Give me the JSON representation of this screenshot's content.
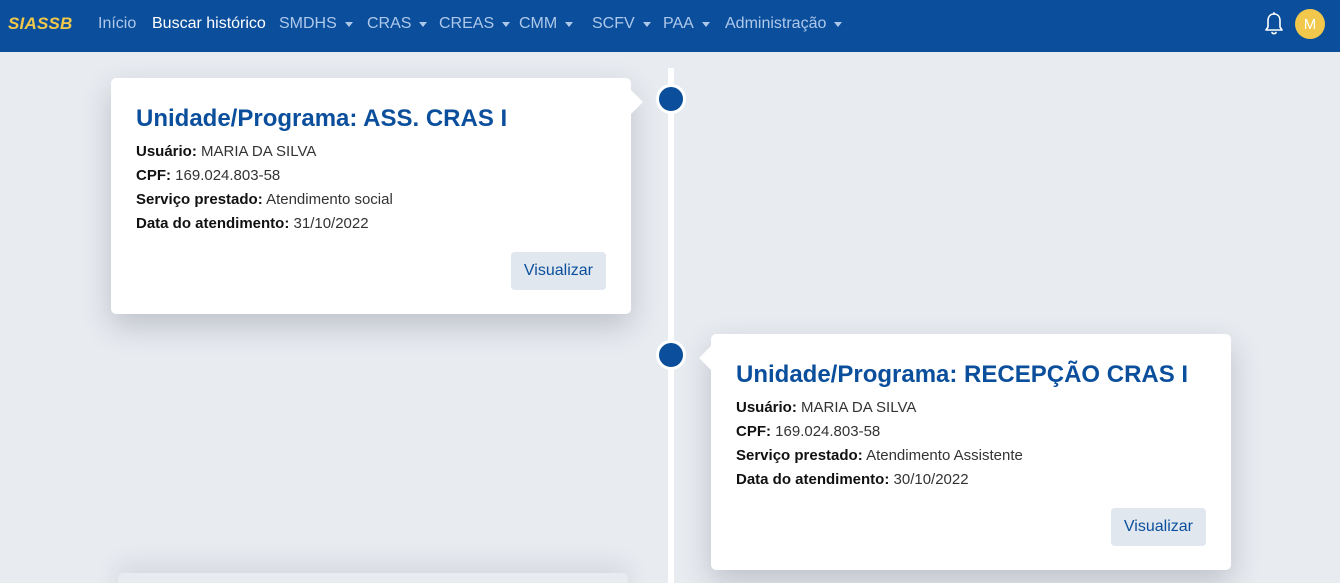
{
  "navbar": {
    "brand": "SIASSB",
    "items": [
      {
        "label": "Início",
        "dropdown": false,
        "active": false
      },
      {
        "label": "Buscar histórico",
        "dropdown": false,
        "active": true
      },
      {
        "label": "SMDHS",
        "dropdown": true,
        "active": false
      },
      {
        "label": "CRAS",
        "dropdown": true,
        "active": false
      },
      {
        "label": "CREAS",
        "dropdown": true,
        "active": false
      },
      {
        "label": "CMM",
        "dropdown": true,
        "active": false
      },
      {
        "label": "SCFV",
        "dropdown": true,
        "active": false
      },
      {
        "label": "PAA",
        "dropdown": true,
        "active": false
      },
      {
        "label": "Administração",
        "dropdown": true,
        "active": false
      }
    ],
    "bell_icon": "bell-icon",
    "avatar_initial": "M"
  },
  "labels": {
    "user": "Usuário:",
    "cpf": "CPF:",
    "service": "Serviço prestado:",
    "date": "Data do atendimento:",
    "view_button": "Visualizar"
  },
  "timeline": [
    {
      "title": "Unidade/Programa: ASS. CRAS I",
      "user": "MARIA DA SILVA",
      "cpf": "169.024.803-58",
      "service": "Atendimento social",
      "date": "31/10/2022",
      "button": "Visualizar"
    },
    {
      "title": "Unidade/Programa: RECEPÇÃO CRAS I",
      "user": "MARIA DA SILVA",
      "cpf": "169.024.803-58",
      "service": "Atendimento Assistente",
      "date": "30/10/2022",
      "button": "Visualizar"
    }
  ],
  "colors": {
    "primary": "#0b4f9c",
    "brand_accent": "#f1c84b",
    "background": "#e8ebf0",
    "button_bg": "#e1e7ef"
  }
}
